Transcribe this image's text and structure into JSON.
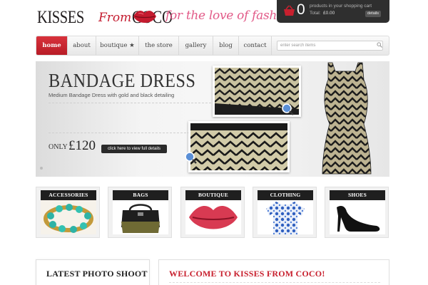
{
  "header": {
    "logo": {
      "kisses": "KISSES",
      "from": "From",
      "coco": "COCO"
    },
    "tagline": "for the love of fashion!",
    "cart": {
      "count": "0",
      "text": "products in your shopping cart",
      "total_label": "Total:",
      "total_value": "£0.00",
      "details_label": "details"
    }
  },
  "nav": {
    "items": [
      {
        "label": "home",
        "active": true
      },
      {
        "label": "about"
      },
      {
        "label": "boutique ★"
      },
      {
        "label": "the store"
      },
      {
        "label": "gallery"
      },
      {
        "label": "blog"
      },
      {
        "label": "contact"
      }
    ],
    "search_placeholder": "enter search items"
  },
  "hero": {
    "title": "BANDAGE DRESS",
    "subtitle": "Medium Bandage Dress with gold and black detailing",
    "only": "ONLY",
    "price": "£120",
    "button": "click here to view full details"
  },
  "categories": [
    {
      "label": "ACCESSORIES"
    },
    {
      "label": "BAGS"
    },
    {
      "label": "BOUTIQUE"
    },
    {
      "label": "CLOTHING"
    },
    {
      "label": "SHOES"
    }
  ],
  "sections": {
    "photo_shoot": "LATEST PHOTO SHOOT",
    "welcome": "WELCOME TO KISSES FROM COCO!"
  },
  "colors": {
    "accent": "#c8202e",
    "tagline": "#e25a88",
    "cart_bg": "#2f2f2f"
  }
}
